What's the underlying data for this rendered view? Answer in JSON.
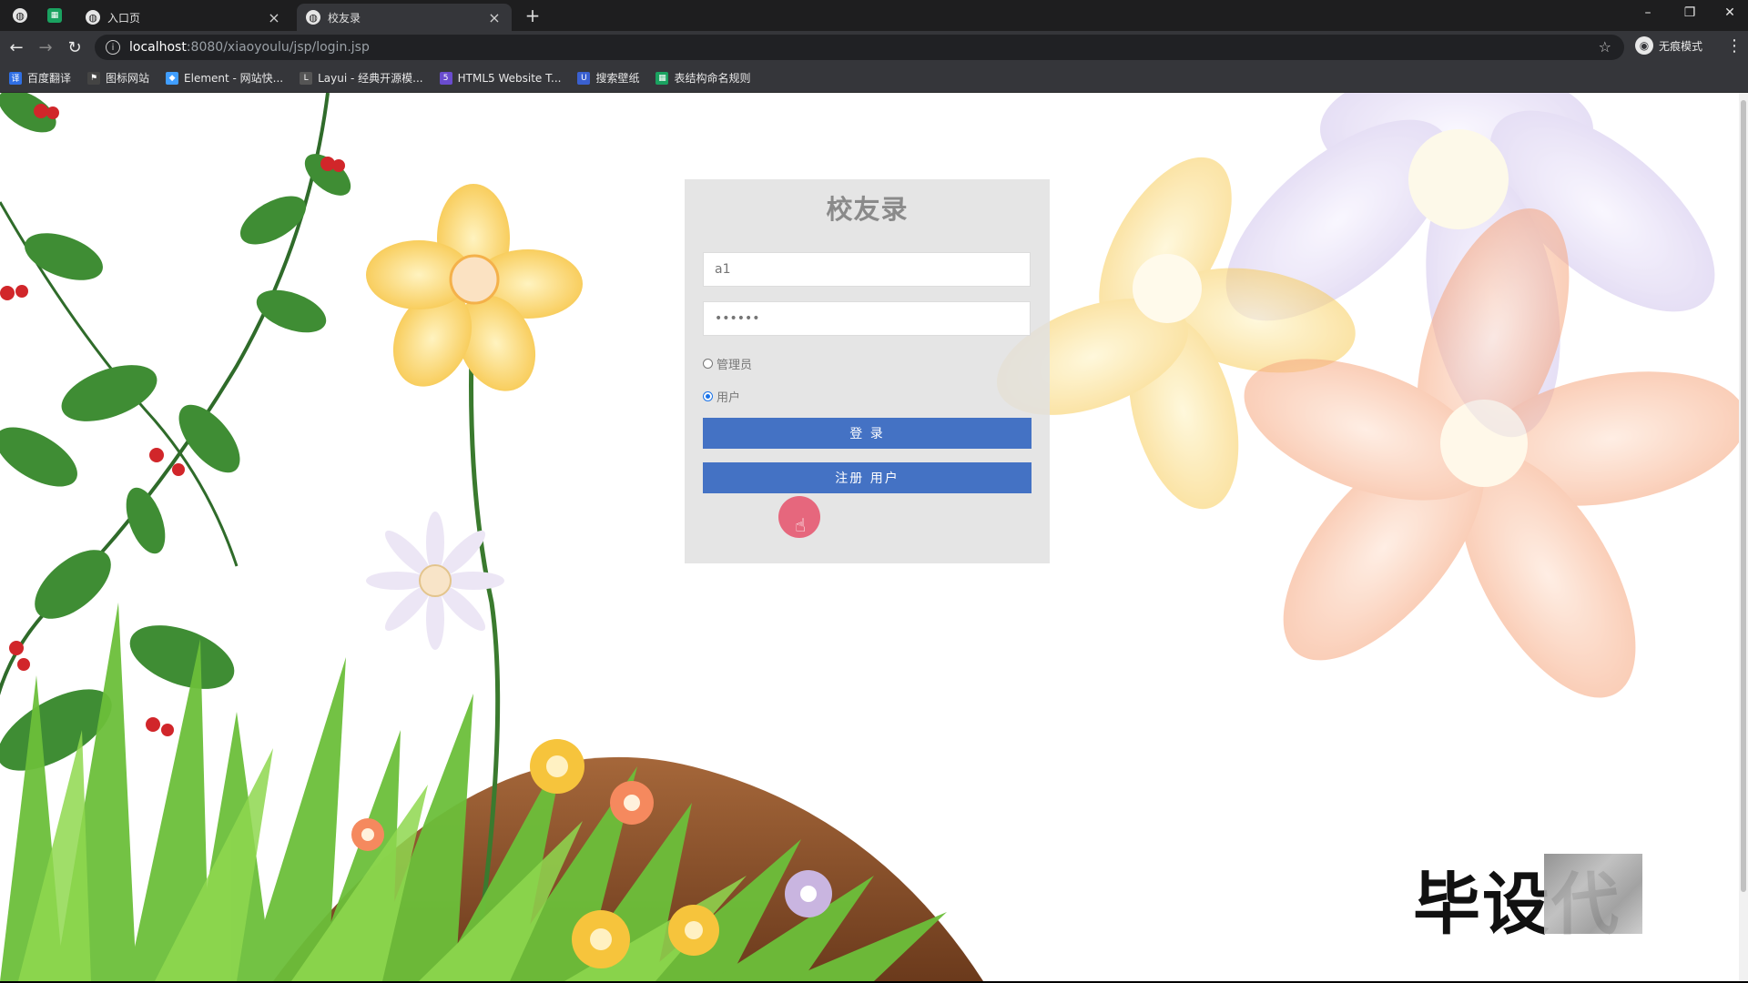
{
  "browser": {
    "tabs": [
      {
        "title": "入口页",
        "active": false
      },
      {
        "title": "校友录",
        "active": true
      }
    ],
    "url_host": "localhost",
    "url_path": ":8080/xiaoyoulu/jsp/login.jsp",
    "incognito_label": "无痕模式",
    "bookmarks": [
      {
        "label": "百度翻译",
        "color": "#2f6fe4"
      },
      {
        "label": "图标网站",
        "color": "#444444"
      },
      {
        "label": "Element - 网站快...",
        "color": "#409eff"
      },
      {
        "label": "Layui - 经典开源模...",
        "color": "#555555"
      },
      {
        "label": "HTML5 Website T...",
        "color": "#6a4ccf"
      },
      {
        "label": "搜索壁纸",
        "color": "#3a60d0"
      },
      {
        "label": "表结构命名规则",
        "color": "#1aa260"
      }
    ]
  },
  "login": {
    "title": "校友录",
    "username_value": "a1",
    "password_value": "••••••",
    "roles": [
      {
        "label": "管理员",
        "checked": false
      },
      {
        "label": "用户",
        "checked": true
      }
    ],
    "login_button": "登 录",
    "register_button": "注册 用户"
  },
  "watermark": {
    "text": "毕设代"
  },
  "colors": {
    "button": "#4472c4",
    "panel": "#e1e1e1",
    "chrome_dark": "#1e1e1f",
    "toolbar": "#35363a"
  }
}
